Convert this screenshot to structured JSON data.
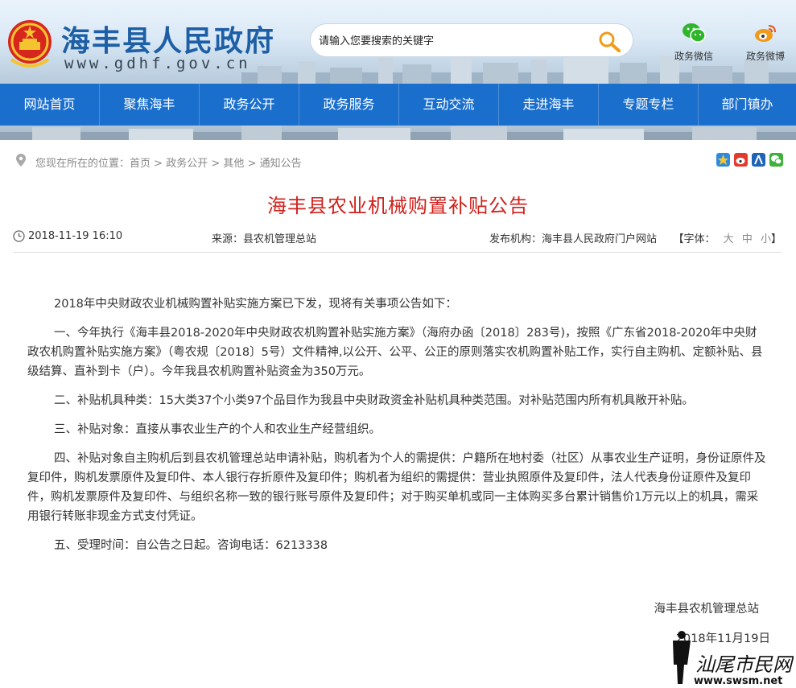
{
  "header": {
    "site_title": "海丰县人民政府",
    "site_url": "www.gdhf.gov.cn",
    "search_placeholder": "请输入您要搜索的关键字",
    "wechat_label": "政务微信",
    "weibo_label": "政务微博"
  },
  "nav": {
    "items": [
      "网站首页",
      "聚焦海丰",
      "政务公开",
      "政务服务",
      "互动交流",
      "走进海丰",
      "专题专栏",
      "部门镇办"
    ]
  },
  "breadcrumb": {
    "prefix": "您现在所在的位置：",
    "items": [
      "首页",
      "政务公开",
      "其他",
      "通知公告"
    ],
    "separator": ">"
  },
  "share_icons": [
    "qzone-icon",
    "weibo-icon",
    "renren-icon",
    "wechat-icon"
  ],
  "article": {
    "title": "海丰县农业机械购置补贴公告",
    "datetime": "2018-11-19 16:10",
    "source_label": "来源：",
    "source": "县农机管理总站",
    "publisher_label": "发布机构：",
    "publisher": "海丰县人民政府门户网站",
    "font_label": "【字体：",
    "font_sizes": [
      "大",
      "中",
      "小"
    ],
    "font_close": "】",
    "paragraphs": [
      "2018年中央财政农业机械购置补贴实施方案已下发，现将有关事项公告如下：",
      "一、今年执行《海丰县2018-2020年中央财政农机购置补贴实施方案》（海府办函〔2018〕283号)，按照《广东省2018-2020年中央财政农机购置补贴实施方案》（粤农规〔2018〕5号）文件精神,以公开、公平、公正的原则落实农机购置补贴工作，实行自主购机、定额补贴、县级结算、直补到卡（户）。今年我县农机购置补贴资金为350万元。",
      "二、补贴机具种类：15大类37个小类97个品目作为我县中央财政资金补贴机具种类范围。对补贴范围内所有机具敞开补贴。",
      "三、补贴对象：直接从事农业生产的个人和农业生产经营组织。",
      "四、补贴对象自主购机后到县农机管理总站申请补贴，购机者为个人的需提供：户籍所在地村委（社区）从事农业生产证明，身份证原件及复印件，购机发票原件及复印件、本人银行存折原件及复印件；购机者为组织的需提供：营业执照原件及复印件，法人代表身份证原件及复印件，购机发票原件及复印件、与组织名称一致的银行账号原件及复印件；对于购买单机或同一主体购买多台累计销售价1万元以上的机具，需采用银行转账非现金方式支付凭证。",
      "五、受理时间：自公告之日起。咨询电话：6213338"
    ],
    "signature": "海丰县农机管理总站",
    "sign_date": "2018年11月19日"
  },
  "watermark": {
    "text": "汕尾市民网",
    "url": "www.swsm.net"
  },
  "colors": {
    "nav_bg": "#1a6fcd",
    "title_red": "#d0211c",
    "brand_blue": "#1d5fa6"
  }
}
